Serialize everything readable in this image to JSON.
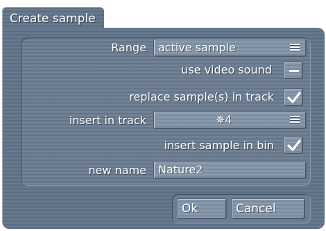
{
  "dialog": {
    "title": "Create sample"
  },
  "form": {
    "range": {
      "label": "Range",
      "value": "active sample",
      "icon": "menu-icon"
    },
    "use_video_sound": {
      "label": "use video sound",
      "checked": false,
      "icon": "dash-icon"
    },
    "replace_samples": {
      "label": "replace sample(s) in track",
      "checked": true,
      "icon": "checkmark-icon"
    },
    "insert_in_track": {
      "label": "insert in track",
      "value": "✵4",
      "icon": "menu-icon"
    },
    "insert_in_bin": {
      "label": "insert sample in bin",
      "checked": true,
      "icon": "checkmark-icon"
    },
    "new_name": {
      "label": "new name",
      "value": "Nature2"
    }
  },
  "buttons": {
    "ok": "Ok",
    "cancel": "Cancel"
  },
  "colors": {
    "panel": "#61748a",
    "inner_panel": "#6b7d92",
    "control": "#8496aa",
    "text": "#ffffff"
  }
}
